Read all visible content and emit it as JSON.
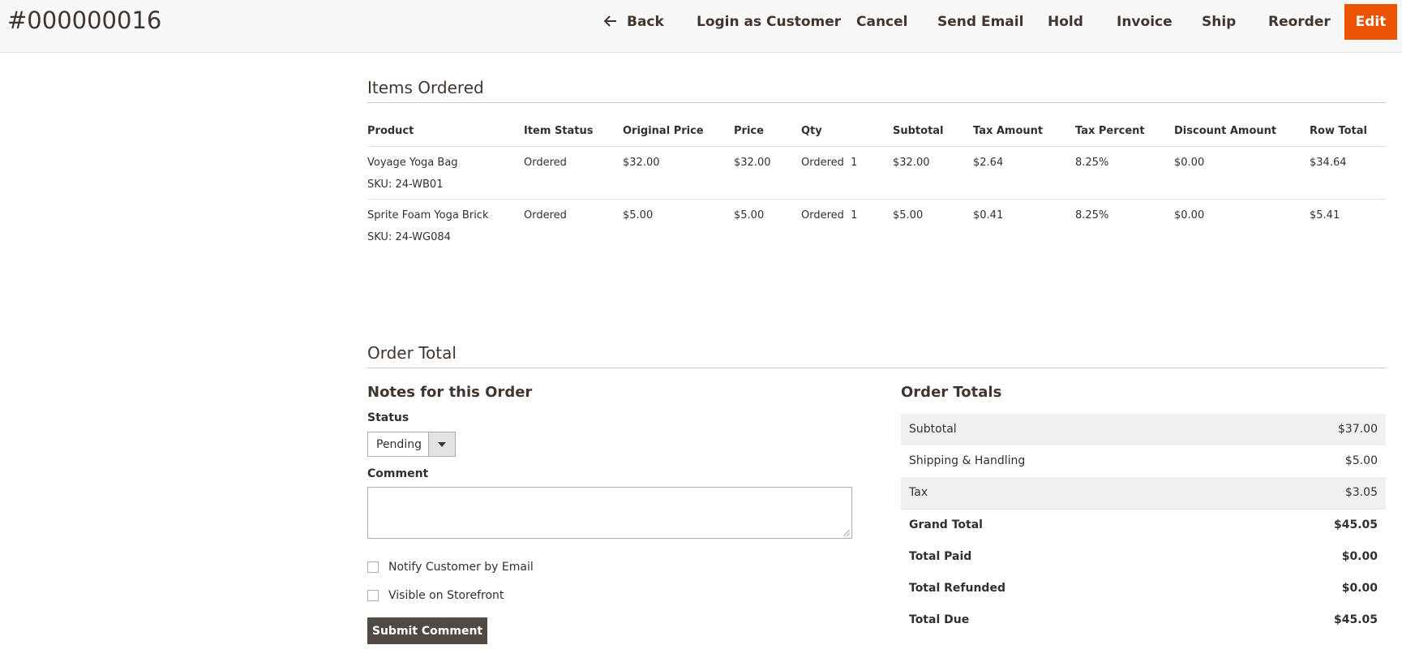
{
  "header": {
    "order_number": "#000000016",
    "actions": {
      "back": "Back",
      "login_as_customer": "Login as Customer",
      "cancel": "Cancel",
      "send_email": "Send Email",
      "hold": "Hold",
      "invoice": "Invoice",
      "ship": "Ship",
      "reorder": "Reorder",
      "edit": "Edit"
    },
    "accent_color": "#eb5202"
  },
  "items_ordered": {
    "title": "Items Ordered",
    "columns": [
      "Product",
      "Item Status",
      "Original Price",
      "Price",
      "Qty",
      "Subtotal",
      "Tax Amount",
      "Tax Percent",
      "Discount Amount",
      "Row Total"
    ],
    "rows": [
      {
        "product": "Voyage Yoga Bag",
        "sku": "SKU: 24-WB01",
        "item_status": "Ordered",
        "original_price": "$32.00",
        "price": "$32.00",
        "qty": "Ordered  1",
        "subtotal": "$32.00",
        "tax_amount": "$2.64",
        "tax_percent": "8.25%",
        "discount_amount": "$0.00",
        "row_total": "$34.64"
      },
      {
        "product": "Sprite Foam Yoga Brick",
        "sku": "SKU: 24-WG084",
        "item_status": "Ordered",
        "original_price": "$5.00",
        "price": "$5.00",
        "qty": "Ordered  1",
        "subtotal": "$5.00",
        "tax_amount": "$0.41",
        "tax_percent": "8.25%",
        "discount_amount": "$0.00",
        "row_total": "$5.41"
      }
    ]
  },
  "order_total": {
    "title": "Order Total",
    "notes": {
      "title": "Notes for this Order",
      "status_label": "Status",
      "status_value": "Pending",
      "comment_label": "Comment",
      "comment_value": "",
      "notify_label": "Notify Customer by Email",
      "visible_label": "Visible on Storefront",
      "submit_label": "Submit Comment"
    },
    "totals": {
      "title": "Order Totals",
      "rows": [
        {
          "label": "Subtotal",
          "value": "$37.00"
        },
        {
          "label": "Shipping & Handling",
          "value": "$5.00"
        },
        {
          "label": "Tax",
          "value": "$3.05"
        },
        {
          "label": "Grand Total",
          "value": "$45.05"
        },
        {
          "label": "Total Paid",
          "value": "$0.00"
        },
        {
          "label": "Total Refunded",
          "value": "$0.00"
        },
        {
          "label": "Total Due",
          "value": "$45.05"
        }
      ]
    }
  }
}
